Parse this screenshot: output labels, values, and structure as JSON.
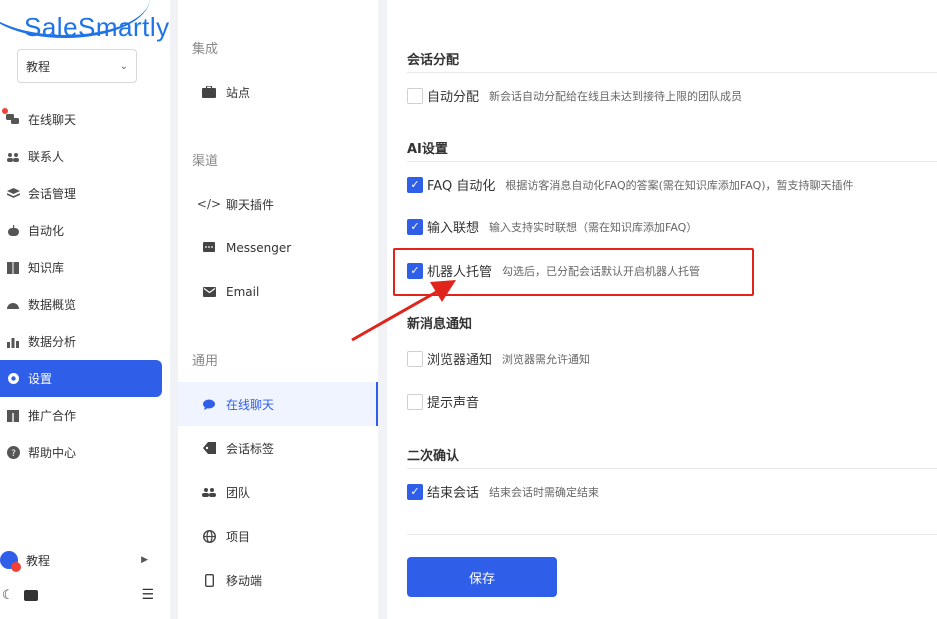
{
  "brand": {
    "logo_text": "SaleSmartly"
  },
  "workspace": {
    "selected": "教程"
  },
  "sidebar": {
    "items": [
      {
        "label": "在线聊天",
        "icon": "chat-bubbles-icon"
      },
      {
        "label": "联系人",
        "icon": "contacts-icon"
      },
      {
        "label": "会话管理",
        "icon": "layers-icon"
      },
      {
        "label": "自动化",
        "icon": "robot-icon"
      },
      {
        "label": "知识库",
        "icon": "book-icon"
      },
      {
        "label": "数据概览",
        "icon": "gauge-icon"
      },
      {
        "label": "数据分析",
        "icon": "bar-chart-icon"
      },
      {
        "label": "设置",
        "icon": "gear-icon"
      },
      {
        "label": "推广合作",
        "icon": "gift-icon"
      },
      {
        "label": "帮助中心",
        "icon": "help-icon"
      }
    ],
    "user": {
      "name": "教程"
    }
  },
  "settings_nav": {
    "sections": [
      {
        "title": "集成",
        "items": [
          {
            "label": "站点",
            "icon": "briefcase-icon"
          }
        ]
      },
      {
        "title": "渠道",
        "items": [
          {
            "label": "聊天插件",
            "icon": "code-icon"
          },
          {
            "label": "Messenger",
            "icon": "message-square-icon"
          },
          {
            "label": "Email",
            "icon": "mail-icon"
          }
        ]
      },
      {
        "title": "通用",
        "items": [
          {
            "label": "在线聊天",
            "icon": "chat-icon"
          },
          {
            "label": "会话标签",
            "icon": "tag-icon"
          },
          {
            "label": "团队",
            "icon": "team-icon"
          },
          {
            "label": "项目",
            "icon": "globe-icon"
          },
          {
            "label": "移动端",
            "icon": "mobile-icon"
          }
        ]
      }
    ]
  },
  "content": {
    "groups": [
      {
        "title": "会话分配",
        "options": [
          {
            "label": "自动分配",
            "desc": "新会话自动分配给在线且未达到接待上限的团队成员",
            "checked": false
          }
        ]
      },
      {
        "title": "AI设置",
        "options": [
          {
            "label": "FAQ 自动化",
            "desc": "根据访客消息自动化FAQ的答案(需在知识库添加FAQ)，暂支持聊天插件",
            "checked": true
          },
          {
            "label": "输入联想",
            "desc": "输入支持实时联想（需在知识库添加FAQ）",
            "checked": true
          },
          {
            "label": "机器人托管",
            "desc": "勾选后，已分配会话默认开启机器人托管",
            "checked": true
          }
        ]
      },
      {
        "title": "新消息通知",
        "options": [
          {
            "label": "浏览器通知",
            "desc": "浏览器需允许通知",
            "checked": false
          },
          {
            "label": "提示声音",
            "desc": "",
            "checked": false
          }
        ]
      },
      {
        "title": "二次确认",
        "options": [
          {
            "label": "结束会话",
            "desc": "结束会话时需确定结束",
            "checked": true
          }
        ]
      }
    ],
    "save_label": "保存"
  },
  "colors": {
    "accent": "#2f5ee8",
    "highlight": "#e0241b",
    "brand": "#1e73e8"
  }
}
